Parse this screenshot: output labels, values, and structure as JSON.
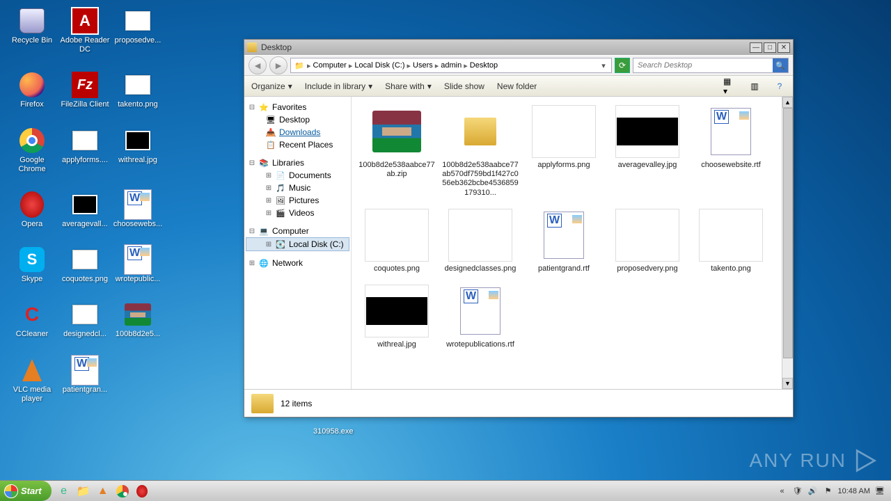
{
  "desktop": {
    "icons": [
      {
        "label": "Recycle Bin",
        "ic": "recycle"
      },
      {
        "label": "Adobe Reader DC",
        "ic": "adobe"
      },
      {
        "label": "proposedve...",
        "ic": "imgw"
      },
      {
        "label": "Firefox",
        "ic": "firefox"
      },
      {
        "label": "FileZilla Client",
        "ic": "filezilla"
      },
      {
        "label": "takento.png",
        "ic": "imgw"
      },
      {
        "label": "Google Chrome",
        "ic": "chrome"
      },
      {
        "label": "applyforms....",
        "ic": "imgw"
      },
      {
        "label": "withreal.jpg",
        "ic": "imgb"
      },
      {
        "label": "Opera",
        "ic": "opera"
      },
      {
        "label": "averagevall...",
        "ic": "imgb"
      },
      {
        "label": "choosewebs...",
        "ic": "word"
      },
      {
        "label": "Skype",
        "ic": "skype"
      },
      {
        "label": "coquotes.png",
        "ic": "imgw"
      },
      {
        "label": "wrotepublic...",
        "ic": "word"
      },
      {
        "label": "CCleaner",
        "ic": "ccleaner"
      },
      {
        "label": "designedcl...",
        "ic": "imgw"
      },
      {
        "label": "100b8d2e5...",
        "ic": "winrar"
      },
      {
        "label": "VLC media player",
        "ic": "vlc"
      },
      {
        "label": "patientgran...",
        "ic": "word"
      }
    ]
  },
  "stray_file": "310958.exe",
  "watermark": "ANY    RUN",
  "explorer": {
    "title": "Desktop",
    "breadcrumbs": [
      "Computer",
      "Local Disk (C:)",
      "Users",
      "admin",
      "Desktop"
    ],
    "search_placeholder": "Search Desktop",
    "toolbar": {
      "organize": "Organize",
      "include": "Include in library",
      "share": "Share with",
      "slideshow": "Slide show",
      "newfolder": "New folder"
    },
    "nav": {
      "favorites": {
        "label": "Favorites",
        "items": [
          "Desktop",
          "Downloads",
          "Recent Places"
        ]
      },
      "libraries": {
        "label": "Libraries",
        "items": [
          "Documents",
          "Music",
          "Pictures",
          "Videos"
        ]
      },
      "computer": {
        "label": "Computer",
        "items": [
          "Local Disk (C:)"
        ]
      },
      "network": {
        "label": "Network"
      }
    },
    "files": [
      {
        "name": "100b8d2e538aabce77ab.zip",
        "thumb": "winrar"
      },
      {
        "name": "100b8d2e538aabce77ab570df759bd1f427c056eb362bcbe4536859179310...",
        "thumb": "folder"
      },
      {
        "name": "applyforms.png",
        "thumb": "white"
      },
      {
        "name": "averagevalley.jpg",
        "thumb": "black"
      },
      {
        "name": "choosewebsite.rtf",
        "thumb": "word"
      },
      {
        "name": "coquotes.png",
        "thumb": "white"
      },
      {
        "name": "designedclasses.png",
        "thumb": "white"
      },
      {
        "name": "patientgrand.rtf",
        "thumb": "word"
      },
      {
        "name": "proposedvery.png",
        "thumb": "white"
      },
      {
        "name": "takento.png",
        "thumb": "white"
      },
      {
        "name": "withreal.jpg",
        "thumb": "black"
      },
      {
        "name": "wrotepublications.rtf",
        "thumb": "word"
      }
    ],
    "status": "12 items"
  },
  "taskbar": {
    "start": "Start",
    "clock": "10:48 AM"
  }
}
